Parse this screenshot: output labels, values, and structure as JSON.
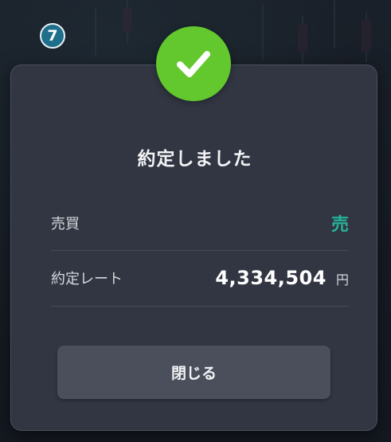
{
  "step_badge": "7",
  "dialog": {
    "title": "約定しました",
    "rows": [
      {
        "label": "売買",
        "value": "売"
      },
      {
        "label": "約定レート",
        "value": "4,334,504",
        "unit": "円"
      }
    ],
    "close_label": "閉じる"
  },
  "colors": {
    "success": "#62c82d",
    "sell": "#26b39a",
    "modal_bg": "#313642",
    "button_bg": "#4a4f5b"
  },
  "icons": {
    "status": "check-icon"
  }
}
